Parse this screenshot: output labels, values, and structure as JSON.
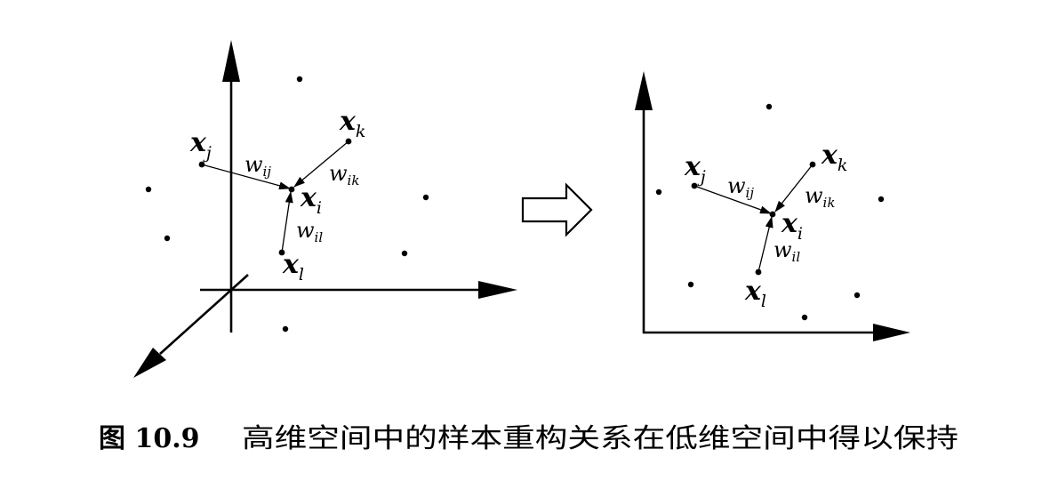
{
  "left_panel": {
    "labels": {
      "xj": {
        "base": "x",
        "sub": "j"
      },
      "xk": {
        "base": "x",
        "sub": "k"
      },
      "xi": {
        "base": "x",
        "sub": "i"
      },
      "xl": {
        "base": "x",
        "sub": "l"
      }
    },
    "weights": {
      "wij": {
        "base": "w",
        "sub": "ij"
      },
      "wik": {
        "base": "w",
        "sub": "ik"
      },
      "wil": {
        "base": "w",
        "sub": "il"
      }
    }
  },
  "right_panel": {
    "labels": {
      "xj": {
        "base": "x",
        "sub": "j"
      },
      "xk": {
        "base": "x",
        "sub": "k"
      },
      "xi": {
        "base": "x",
        "sub": "i"
      },
      "xl": {
        "base": "x",
        "sub": "l"
      }
    },
    "weights": {
      "wij": {
        "base": "w",
        "sub": "ij"
      },
      "wik": {
        "base": "w",
        "sub": "ik"
      },
      "wil": {
        "base": "w",
        "sub": "il"
      }
    }
  },
  "caption": {
    "number": "图 10.9",
    "text": "高维空间中的样本重构关系在低维空间中得以保持"
  }
}
